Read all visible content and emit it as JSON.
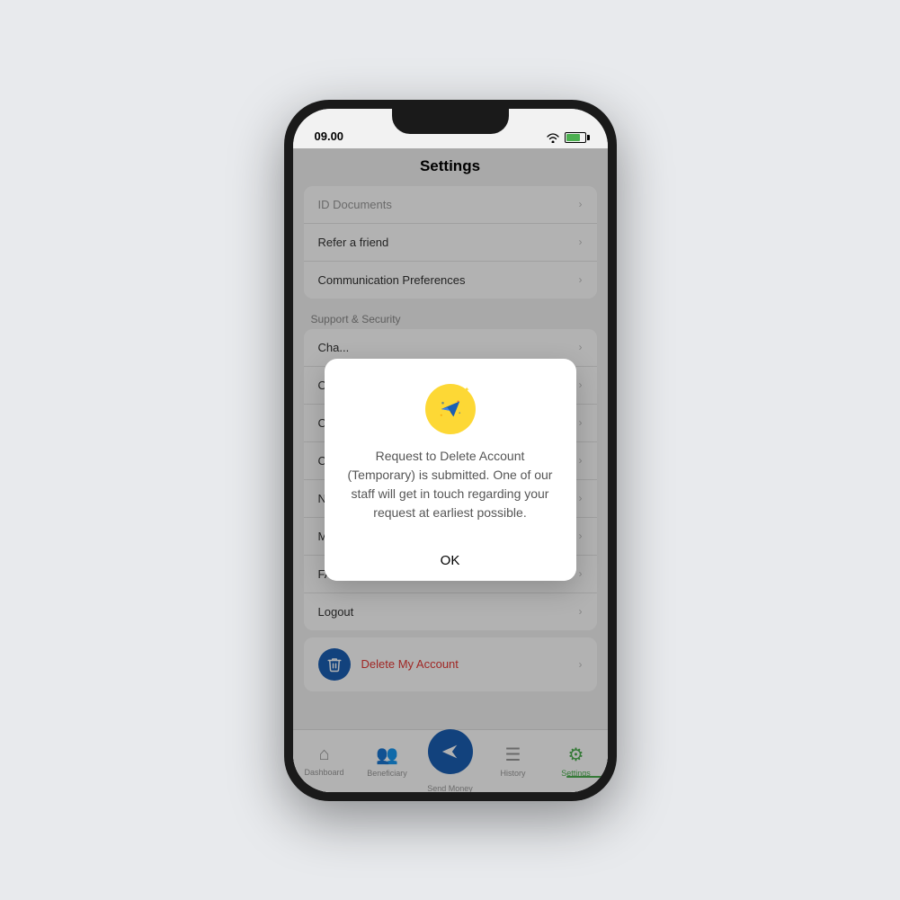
{
  "phone": {
    "status_bar": {
      "time": "09.00",
      "wifi": true,
      "battery_level": 75
    },
    "header": {
      "title": "Settings"
    },
    "settings_items": [
      {
        "label": "ID Documents",
        "dimmed": true
      },
      {
        "label": "Refer a friend",
        "dimmed": false
      },
      {
        "label": "Communication Preferences",
        "dimmed": false
      }
    ],
    "support_section": {
      "label": "Support & Security",
      "items": [
        {
          "label": "Cha...",
          "dimmed": false
        },
        {
          "label": "Our...",
          "dimmed": false
        },
        {
          "label": "Con...",
          "dimmed": false
        },
        {
          "label": "Con...",
          "dimmed": false
        },
        {
          "label": "Not...",
          "dimmed": false
        },
        {
          "label": "Man...",
          "dimmed": false
        },
        {
          "label": "FAQs",
          "dimmed": false
        },
        {
          "label": "Logout",
          "dimmed": false
        }
      ]
    },
    "delete_account": {
      "label": "Delete My Account"
    },
    "bottom_nav": {
      "items": [
        {
          "label": "Dashboard",
          "active": false
        },
        {
          "label": "Beneficiary",
          "active": false
        },
        {
          "label": "Send Money",
          "active": false,
          "is_center": true
        },
        {
          "label": "History",
          "active": false
        },
        {
          "label": "Settings",
          "active": true
        }
      ]
    },
    "dialog": {
      "message": "Request to Delete Account (Temporary) is submitted. One of our staff will get in touch regarding your request at earliest possible.",
      "ok_label": "OK"
    }
  }
}
